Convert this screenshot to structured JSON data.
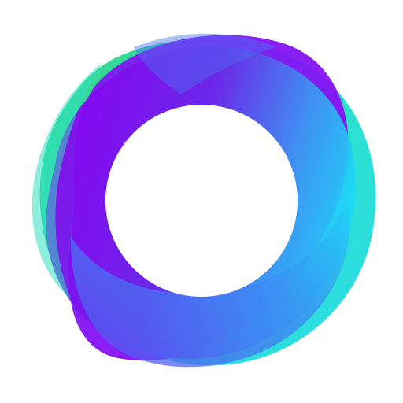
{
  "logo": {
    "icon": "ring-logo-icon",
    "colors": {
      "background": "#ffffff",
      "purple": "#8a00f2",
      "violet": "#6a18e6",
      "blue": "#3aa0f0",
      "cyan": "#18d8f8",
      "teal": "#2fe0b4",
      "green": "#2ed47a"
    }
  }
}
